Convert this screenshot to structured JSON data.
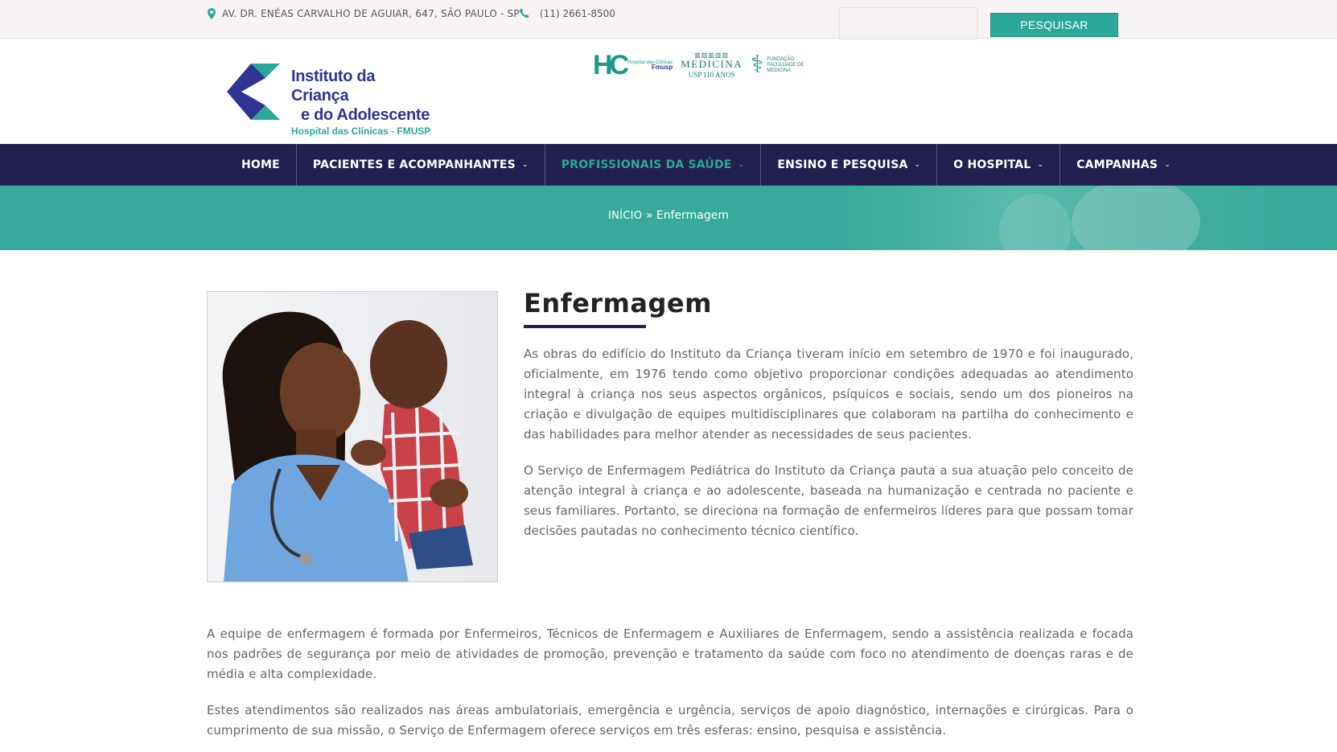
{
  "topbar": {
    "address": "AV. DR. ENÉAS CARVALHO DE AGUIAR, 647, SÃO PAULO - SP",
    "phone": "(11) 2661-8500",
    "search_placeholder": "",
    "search_button": "PESQUISAR"
  },
  "logo": {
    "line1": "Instituto da Criança",
    "line2": "e do Adolescente",
    "line3": "Hospital das Clínicas - FMUSP"
  },
  "partners": {
    "hc_mark": "HC",
    "hc_small": "Hospital das Clínicas",
    "hc_fmusp": "Fmusp",
    "medicina_label": "MEDICINA",
    "medicina_sub": "USP 110 ANOS",
    "fundacao": "FUNDAÇÃO FACULDADE DE MEDICINA"
  },
  "nav": {
    "items": [
      {
        "label": "HOME",
        "dropdown": false
      },
      {
        "label": "PACIENTES E ACOMPANHANTES",
        "dropdown": true
      },
      {
        "label": "PROFISSIONAIS DA SAÚDE",
        "dropdown": true,
        "active": true
      },
      {
        "label": "ENSINO E PESQUISA",
        "dropdown": true
      },
      {
        "label": "O HOSPITAL",
        "dropdown": true
      },
      {
        "label": "CAMPANHAS",
        "dropdown": true
      }
    ]
  },
  "breadcrumb": {
    "home": "INÍCIO",
    "separator": "»",
    "current": "Enfermagem"
  },
  "content": {
    "title": "Enfermagem",
    "p1": "As obras do edifício do Instituto da Criança tiveram início em setembro de 1970 e foi inaugurado, oficialmente, em 1976 tendo como objetivo proporcionar condições adequadas ao atendimento integral à criança nos seus aspectos orgânicos, psíquicos e sociais, sendo um dos pioneiros na criação e divulgação de equipes multidisciplinares que colaboram na partilha do conhecimento e das habilidades para melhor atender as necessidades de seus pacientes.",
    "p2": "O Serviço de Enfermagem Pediátrica do Instituto da Criança pauta a sua atuação pelo conceito de atenção integral à criança e ao adolescente, baseada na humanização e centrada no paciente e seus familiares. Portanto, se direciona na formação de enfermeiros líderes para que possam tomar decisões pautadas no conhecimento técnico científico.",
    "p3": "A equipe de enfermagem é formada por Enfermeiros, Técnicos de Enfermagem e Auxiliares de Enfermagem, sendo a assistência realizada e focada nos padrões de segurança por meio de atividades de promoção, prevenção e tratamento da saúde com foco no atendimento de doenças raras e de média e alta complexidade.",
    "p4": "Estes atendimentos são realizados nas áreas ambulatoriais, emergência e urgência, serviços de apoio diagnóstico, internações e cirúrgicas. Para o cumprimento de sua missão, o Serviço de Enfermagem oferece serviços em três esferas: ensino, pesquisa e assistência."
  },
  "colors": {
    "navy": "#21204f",
    "teal": "#2ba89a",
    "banner": "#36aa9c"
  }
}
